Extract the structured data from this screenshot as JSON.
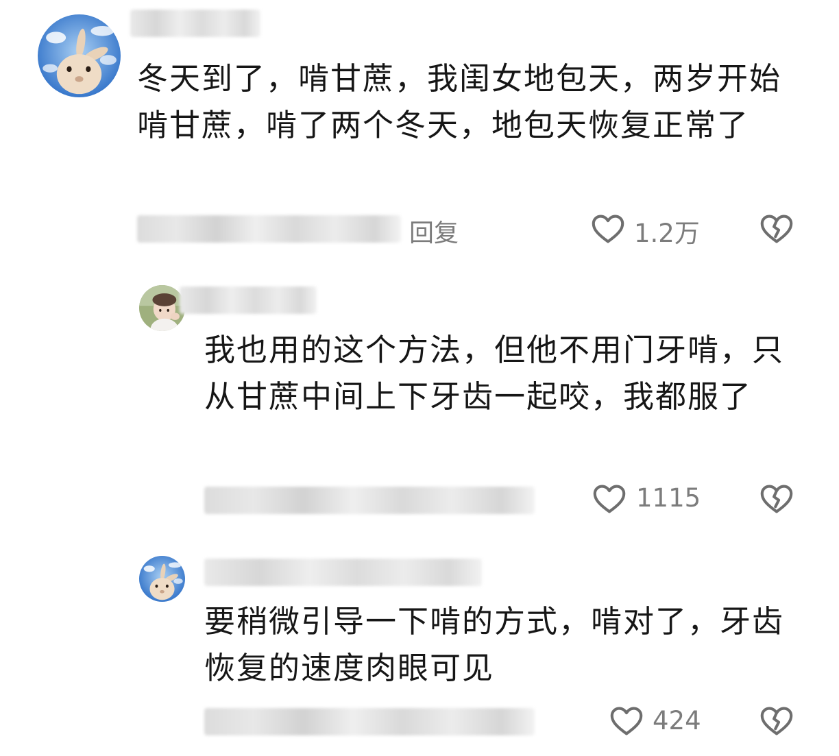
{
  "comments": [
    {
      "text": "冬天到了，啃甘蔗，我闺女地包天，两岁开始啃甘蔗，啃了两个冬天，地包天恢复正常了",
      "reply_label": "回复",
      "likes": "1.2万"
    },
    {
      "text": "我也用的这个方法，但他不用门牙啃，只从甘蔗中间上下牙齿一起咬，我都服了",
      "reply_label": "",
      "likes": "1115"
    },
    {
      "text": "要稍微引导一下啃的方式，啃对了，牙齿恢复的速度肉眼可见",
      "reply_label": "",
      "likes": "424"
    }
  ],
  "icons": {
    "like": "heart-outline-icon",
    "dislike": "broken-heart-icon"
  },
  "colors": {
    "text": "#161616",
    "meta": "#7c7c7c",
    "icon": "#6e6e6e"
  }
}
